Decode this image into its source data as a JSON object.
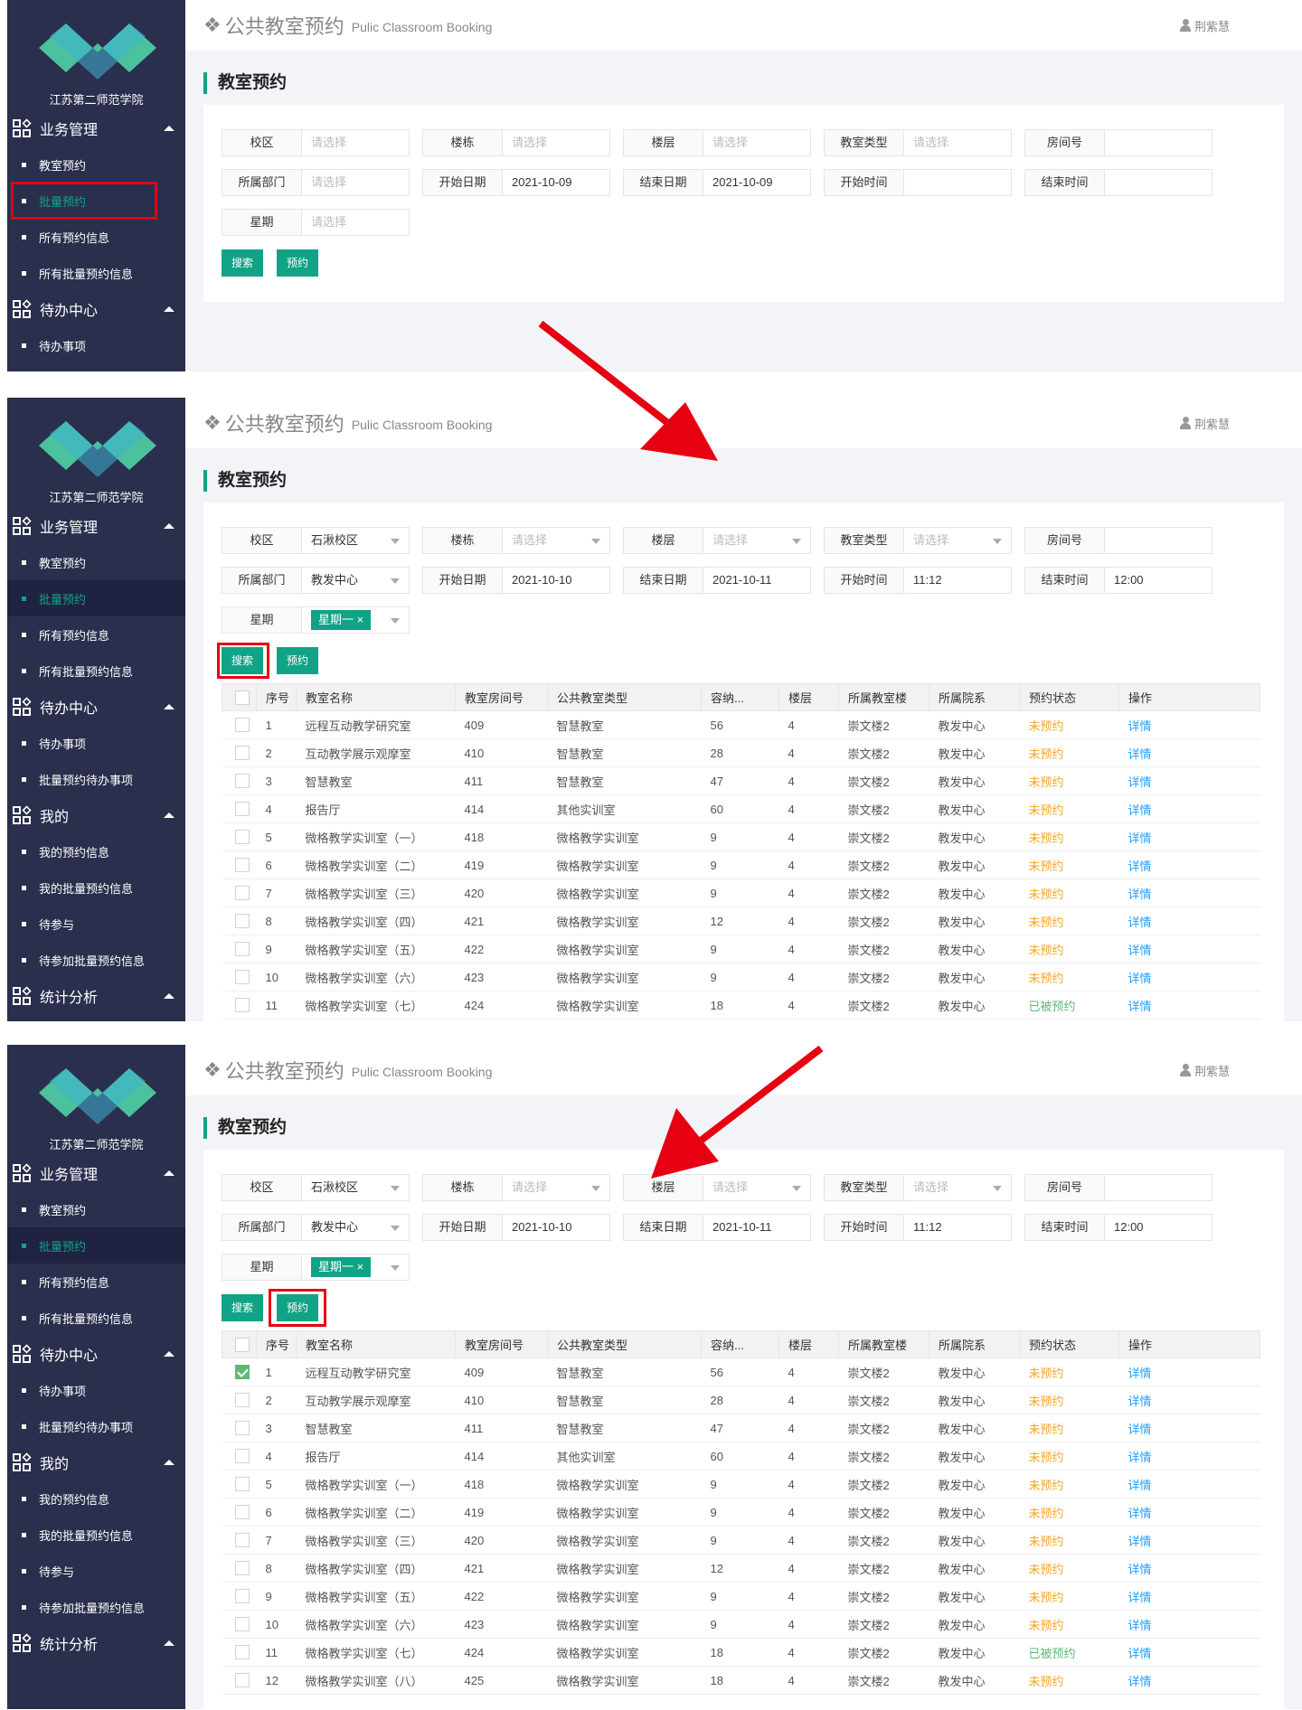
{
  "app": {
    "school_name": "江苏第二师范学院",
    "title_cn": "公共教室预约",
    "title_en": "Pulic Classroom Booking",
    "user": "荆紫慧",
    "section_title": "教室预约"
  },
  "menu": {
    "group_business": "业务管理",
    "item_booking": "教室预约",
    "item_batch": "批量预约",
    "item_all_info": "所有预约信息",
    "item_all_batch_info": "所有批量预约信息",
    "group_todo": "待办中心",
    "item_todo": "待办事项",
    "item_batch_todo": "批量预约待办事项",
    "group_mine": "我的",
    "item_my_info": "我的预约信息",
    "item_my_batch_info": "我的批量预约信息",
    "item_pending": "待参与",
    "item_pending_batch": "待参加批量预约信息",
    "group_stats": "统计分析"
  },
  "labels": {
    "campus": "校区",
    "building": "楼栋",
    "floor": "楼层",
    "room_type": "教室类型",
    "room_no": "房间号",
    "dept": "所属部门",
    "start_date": "开始日期",
    "end_date": "结束日期",
    "start_time": "开始时间",
    "end_time": "结束时间",
    "weekday": "星期",
    "placeholder": "请选择",
    "search_btn": "搜索",
    "book_btn": "预约"
  },
  "filters_p1": {
    "start_date": "2021-10-09",
    "end_date": "2021-10-09"
  },
  "filters_p2": {
    "campus": "石湫校区",
    "dept": "教发中心",
    "start_date": "2021-10-10",
    "end_date": "2021-10-11",
    "start_time": "11:12",
    "end_time": "12:00",
    "weekday_tag": "星期一 ×"
  },
  "table": {
    "headers": [
      "序号",
      "教室名称",
      "教室房间号",
      "公共教室类型",
      "容纳...",
      "楼层",
      "所属教室楼",
      "所属院系",
      "预约状态",
      "操作"
    ],
    "rows": [
      [
        "1",
        "远程互动教学研究室",
        "409",
        "智慧教室",
        "56",
        "4",
        "崇文楼2",
        "教发中心",
        "未预约",
        "详情"
      ],
      [
        "2",
        "互动教学展示观摩室",
        "410",
        "智慧教室",
        "28",
        "4",
        "崇文楼2",
        "教发中心",
        "未预约",
        "详情"
      ],
      [
        "3",
        "智慧教室",
        "411",
        "智慧教室",
        "47",
        "4",
        "崇文楼2",
        "教发中心",
        "未预约",
        "详情"
      ],
      [
        "4",
        "报告厅",
        "414",
        "其他实训室",
        "60",
        "4",
        "崇文楼2",
        "教发中心",
        "未预约",
        "详情"
      ],
      [
        "5",
        "微格教学实训室（一）",
        "418",
        "微格教学实训室",
        "9",
        "4",
        "崇文楼2",
        "教发中心",
        "未预约",
        "详情"
      ],
      [
        "6",
        "微格教学实训室（二）",
        "419",
        "微格教学实训室",
        "9",
        "4",
        "崇文楼2",
        "教发中心",
        "未预约",
        "详情"
      ],
      [
        "7",
        "微格教学实训室（三）",
        "420",
        "微格教学实训室",
        "9",
        "4",
        "崇文楼2",
        "教发中心",
        "未预约",
        "详情"
      ],
      [
        "8",
        "微格教学实训室（四）",
        "421",
        "微格教学实训室",
        "12",
        "4",
        "崇文楼2",
        "教发中心",
        "未预约",
        "详情"
      ],
      [
        "9",
        "微格教学实训室（五）",
        "422",
        "微格教学实训室",
        "9",
        "4",
        "崇文楼2",
        "教发中心",
        "未预约",
        "详情"
      ],
      [
        "10",
        "微格教学实训室（六）",
        "423",
        "微格教学实训室",
        "9",
        "4",
        "崇文楼2",
        "教发中心",
        "未预约",
        "详情"
      ],
      [
        "11",
        "微格教学实训室（七）",
        "424",
        "微格教学实训室",
        "18",
        "4",
        "崇文楼2",
        "教发中心",
        "已被预约",
        "详情"
      ],
      [
        "12",
        "微格教学实训室（八）",
        "425",
        "微格教学实训室",
        "18",
        "4",
        "崇文楼2",
        "教发中心",
        "未预约",
        "详情"
      ]
    ]
  },
  "colors": {
    "accent": "#10a386",
    "sidebar": "#2b2f4e",
    "highlight": "#e60012",
    "pending": "#f5a623",
    "booked": "#5fb878",
    "link": "#1e9fff"
  }
}
